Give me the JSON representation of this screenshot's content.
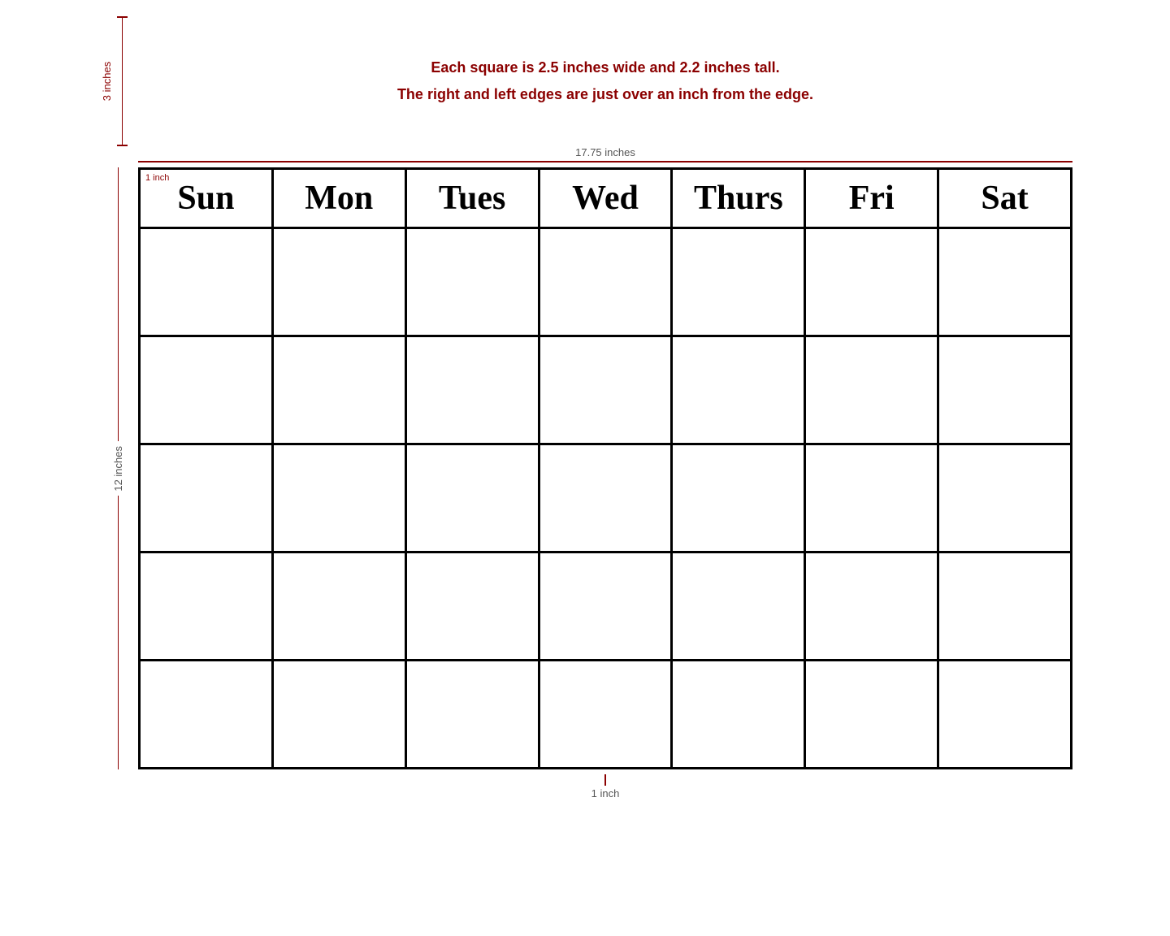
{
  "annotations": {
    "line1": "Each square is 2.5 inches wide and 2.2 inches tall.",
    "line2": "The right and left edges are just over an inch from the edge.",
    "width_label": "17.75 inches",
    "height_label": "12 inches",
    "top_height_label": "3 inches",
    "bottom_inch_label": "1 inch",
    "corner_inch_label": "1 inch"
  },
  "calendar": {
    "days": [
      "Sun",
      "Mon",
      "Tues",
      "Wed",
      "Thurs",
      "Fri",
      "Sat"
    ],
    "num_rows": 5,
    "corner_note": "1 inch"
  }
}
